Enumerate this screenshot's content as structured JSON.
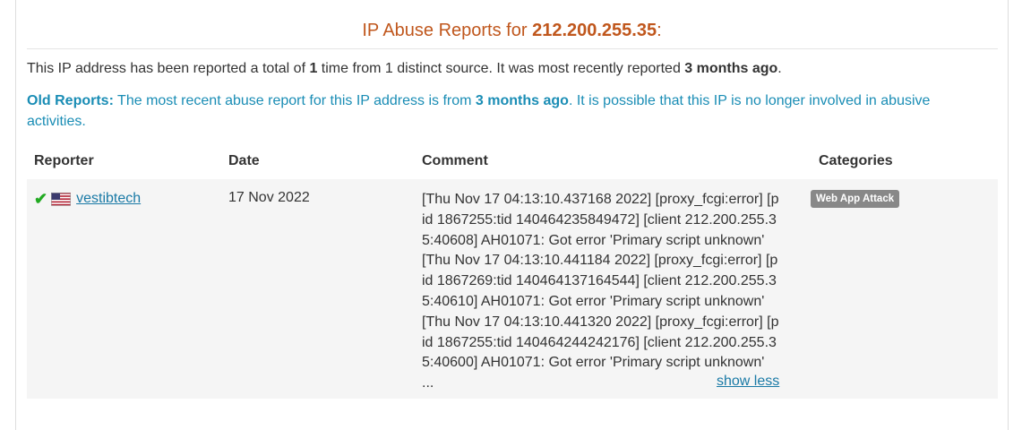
{
  "header": {
    "title_prefix": "IP Abuse Reports for ",
    "ip": "212.200.255.35",
    "title_suffix": ":"
  },
  "summary": {
    "part1": "This IP address has been reported a total of ",
    "count": "1",
    "part2": " time from 1 distinct source. It was most recently reported ",
    "recent": "3 months ago",
    "part3": "."
  },
  "old_reports": {
    "label": "Old Reports:",
    "part1": " The most recent abuse report for this IP address is from ",
    "recent": "3 months ago",
    "part2": ". It is possible that this IP is no longer involved in abusive activities."
  },
  "table": {
    "headers": [
      "Reporter",
      "Date",
      "Comment",
      "Categories"
    ],
    "rows": [
      {
        "reporter": "vestibtech",
        "date": "17 Nov 2022",
        "comment_lines": [
          "[Thu Nov 17 04:13:10.437168 2022] [proxy_fcgi:error] [p",
          "id 1867255:tid 140464235849472] [client 212.200.255.3",
          "5:40608] AH01071: Got error 'Primary script unknown'",
          "[Thu Nov 17 04:13:10.441184 2022] [proxy_fcgi:error] [p",
          "id 1867269:tid 140464137164544] [client 212.200.255.3",
          "5:40610] AH01071: Got error 'Primary script unknown'",
          "[Thu Nov 17 04:13:10.441320 2022] [proxy_fcgi:error] [p",
          "id 1867255:tid 140464244242176] [client 212.200.255.3",
          "5:40600] AH01071: Got error 'Primary script unknown'"
        ],
        "ellipsis": "...",
        "show_less": "show less",
        "category": "Web App Attack",
        "icons": [
          "check-icon",
          "us-flag-icon"
        ]
      }
    ]
  },
  "colors": {
    "title": "#c0571d",
    "link": "#1a7aa6",
    "notice": "#1a8db5",
    "row_bg": "#f5f5f5",
    "badge": "#888888"
  }
}
